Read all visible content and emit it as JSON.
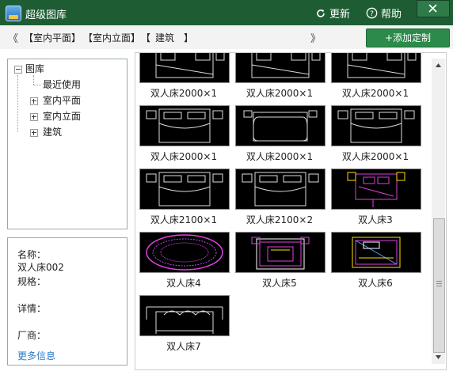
{
  "window": {
    "title": "超级图库"
  },
  "titlebar": {
    "update_label": "更新",
    "help_label": "帮助"
  },
  "nav": {
    "back": "《",
    "forward": "》",
    "crumbs": [
      "【室内平面】",
      "【室内立面】",
      "【",
      "建筑",
      "】"
    ],
    "add_label": "+添加定制"
  },
  "tree": {
    "root": "图库",
    "items": [
      "最近使用",
      "室内平面",
      "室内立面",
      "建筑"
    ]
  },
  "info": {
    "name_label": "名称：",
    "name_value": "双人床002",
    "spec_label": "规格：",
    "detail_label": "详情：",
    "maker_label": "厂商：",
    "more_link": "更多信息"
  },
  "gallery": {
    "items": [
      {
        "caption": "双人床2000×1",
        "kind": "bed-top"
      },
      {
        "caption": "双人床2000×1",
        "kind": "bed-top"
      },
      {
        "caption": "双人床2000×1",
        "kind": "bed-top"
      },
      {
        "caption": "双人床2000×1",
        "kind": "bed-plan"
      },
      {
        "caption": "双人床2000×1",
        "kind": "bed-round"
      },
      {
        "caption": "双人床2000×1",
        "kind": "bed-plan"
      },
      {
        "caption": "双人床2100×1",
        "kind": "bed-plan"
      },
      {
        "caption": "双人床2100×2",
        "kind": "bed-plan"
      },
      {
        "caption": "双人床3",
        "kind": "bed-magenta"
      },
      {
        "caption": "双人床4",
        "kind": "bed-oval"
      },
      {
        "caption": "双人床5",
        "kind": "bed-room"
      },
      {
        "caption": "双人床6",
        "kind": "bed-yellow"
      },
      {
        "caption": "双人床7",
        "kind": "bed-elevation"
      }
    ]
  },
  "colors": {
    "titlebar": "#1e5d34",
    "accent_button": "#2c8a4a",
    "link": "#2a7cc7"
  }
}
